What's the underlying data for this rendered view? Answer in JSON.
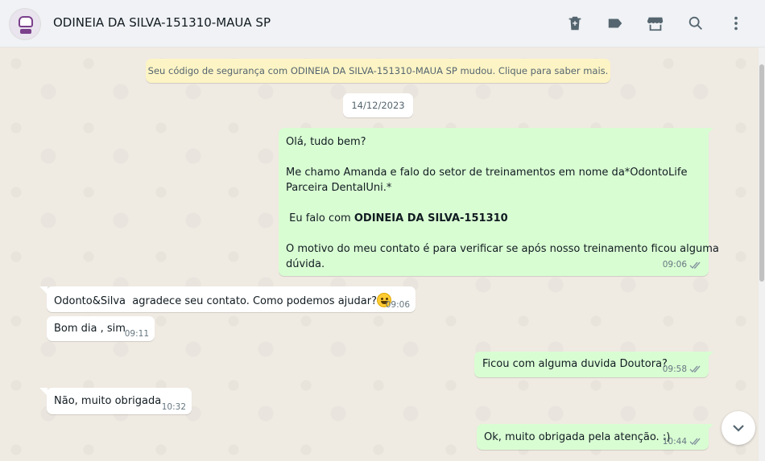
{
  "header": {
    "contact_name": "ODINEIA DA SILVA-151310-MAUA SP",
    "actions": [
      "delete-icon",
      "label-icon",
      "store-icon",
      "search-icon",
      "menu-icon"
    ]
  },
  "system_message": "Seu código de segurança com ODINEIA DA SILVA-151310-MAUA SP mudou. Clique para saber mais.",
  "date_chip": "14/12/2023",
  "messages": {
    "m1": {
      "line1": "Olá, tudo bem?",
      "line2": "Me chamo Amanda e falo do setor de treinamentos em nome da*OdontoLife",
      "line3": "Parceira DentalUni.*",
      "line4_prefix": " Eu falo com ",
      "line4_bold": "ODINEIA DA SILVA-151310",
      "line5": "O motivo do meu contato é para verificar se após nosso treinamento ficou alguma",
      "line6": "dúvida.",
      "time": "09:06"
    },
    "m2": {
      "text": "Odonto&Silva  agradece seu contato. Como podemos ajudar?",
      "time": "09:06"
    },
    "m3": {
      "text": "Bom dia , sim",
      "time": "09:11"
    },
    "m4": {
      "text": "Ficou com alguma duvida Doutora?",
      "time": "09:58"
    },
    "m5": {
      "text": "Não, muito obrigada",
      "time": "10:32"
    },
    "m6": {
      "text": "Ok, muito obrigada pela atenção. :)",
      "time": "10:44"
    }
  },
  "colors": {
    "outgoing_bubble": "#d9fdd3",
    "incoming_bubble": "#ffffff",
    "system_bg": "#fdf4c5",
    "chat_bg": "#efeae2"
  }
}
